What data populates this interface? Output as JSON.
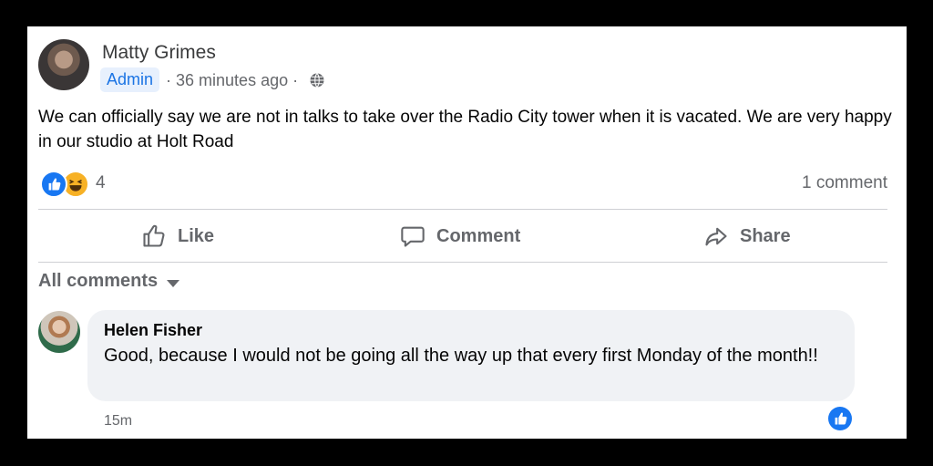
{
  "post": {
    "author": "Matty Grimes",
    "role_badge": "Admin",
    "separator": "·",
    "time": "36 minutes ago",
    "separator2": "·",
    "text": "We can  officially say we are not in  talks to take over the Radio City tower when it is vacated. We are very happy in our studio at Holt Road",
    "reaction_count": "4",
    "comment_count": "1 comment",
    "reactions": [
      "like",
      "haha"
    ]
  },
  "actions": {
    "like": "Like",
    "comment": "Comment",
    "share": "Share"
  },
  "comments_section": {
    "filter_label": "All comments"
  },
  "comment": {
    "author": "Helen Fisher",
    "text": "Good, because I would not be going all the way up that every first Monday of the month!!",
    "time": "15m"
  },
  "colors": {
    "accent": "#1877f2",
    "muted": "#65676b",
    "badge_bg": "#e7f0fd",
    "bubble_bg": "#f0f2f5"
  }
}
